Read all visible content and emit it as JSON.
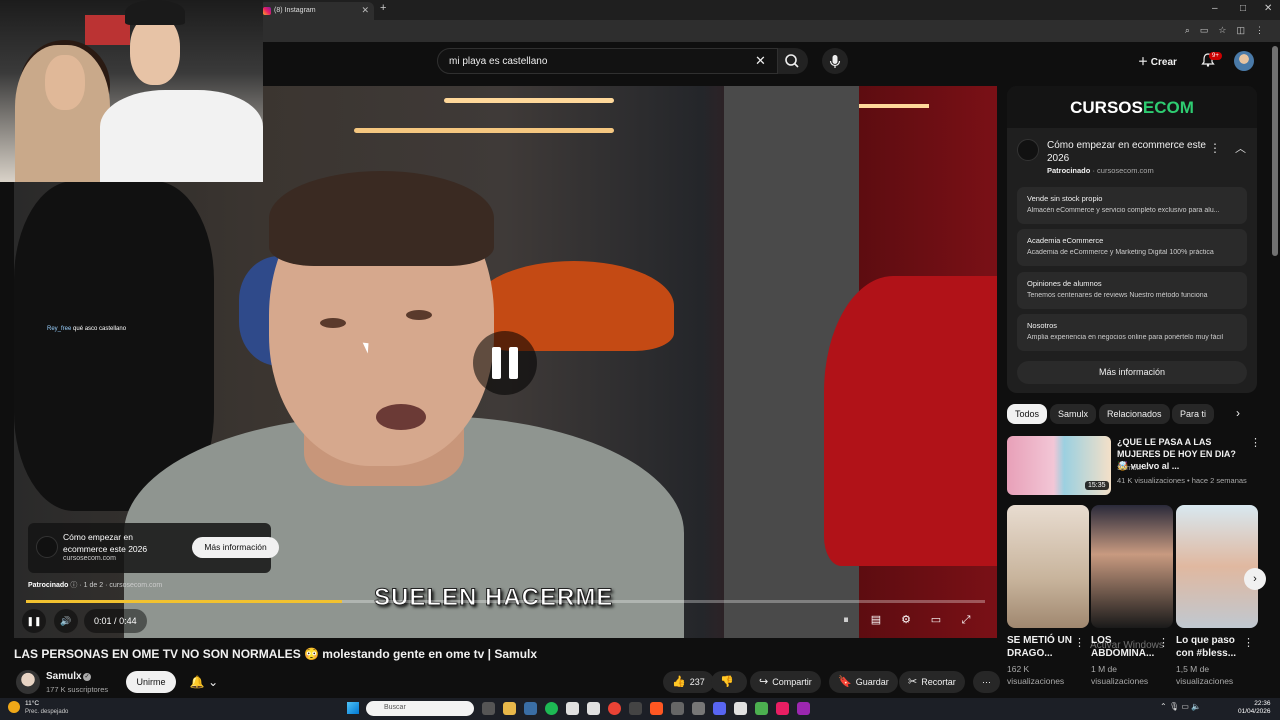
{
  "browser": {
    "tab_title": "(8) Instagram",
    "newtab_glyph": "+",
    "window_controls": [
      "–",
      "□",
      "✕"
    ]
  },
  "header": {
    "search_value": "mi playa es castellano",
    "create_label": "Crear",
    "notifications_badge": "9+"
  },
  "player": {
    "chat_user": "Rey_free",
    "chat_message": "qué asco castellano",
    "caption": "SUELEN HACERME",
    "time_current": "0:01",
    "time_total": "0:44",
    "progress": 0.33,
    "ad": {
      "title": "Cómo empezar en ecommerce este 2026",
      "domain": "cursosecom.com",
      "cta": "Más información",
      "sponsored_label": "Patrocinado",
      "ad_count": "1 de 2",
      "sponsored_domain": "cursosecom.com"
    }
  },
  "video": {
    "title": "LAS PERSONAS EN OME TV NO SON NORMALES 😳 molestando gente en ome tv | Samulx",
    "channel": "Samulx",
    "subscribers": "177 K suscriptores",
    "join_label": "Unirme",
    "likes": "237",
    "share_label": "Compartir",
    "save_label": "Guardar",
    "clip_label": "Recortar"
  },
  "sidebar_ad": {
    "brand_main": "CURSOS",
    "brand_accent": "ECOM",
    "title": "Cómo empezar en ecommerce este 2026",
    "sponsored": "Patrocinado",
    "domain": "cursosecom.com",
    "sitelinks": [
      {
        "title": "Vende sin stock propio",
        "desc": "Almacén eCommerce y servicio completo exclusivo para alu..."
      },
      {
        "title": "Academia eCommerce",
        "desc": "Academia de eCommerce y Marketing Digital 100% práctica"
      },
      {
        "title": "Opiniones de alumnos",
        "desc": "Tenemos centenares de reviews Nuestro método funciona"
      },
      {
        "title": "Nosotros",
        "desc": "Amplia experiencia en negocios online para ponértelo muy fácil"
      }
    ],
    "more_info": "Más información"
  },
  "chips": [
    "Todos",
    "Samulx",
    "Relacionados",
    "Para ti"
  ],
  "recommended": {
    "title": "¿QUE LE PASA A LAS MUJERES DE HOY EN DIA? 🤯 vuelvo al ...",
    "channel": "Samulx",
    "views": "41 K visualizaciones • hace 2 semanas",
    "duration": "15:35"
  },
  "shorts": [
    {
      "title": "SE METIÓ UN DRAGO...",
      "views": "162 K visualizaciones"
    },
    {
      "title": "LOS ABDOMINA...",
      "views": "1 M de visualizaciones"
    },
    {
      "title": "Lo que paso con #bless...",
      "views": "1,5 M de visualizaciones"
    }
  ],
  "watermark": "Activar Windows",
  "taskbar": {
    "temp": "11°C",
    "weather": "Prec. despejado",
    "search_placeholder": "Buscar",
    "time": "22:36",
    "date": "01/04/2026"
  },
  "colors": {
    "accent_red": "#cc0000",
    "progress": "#f2c230",
    "brand_green": "#2ecc71"
  }
}
